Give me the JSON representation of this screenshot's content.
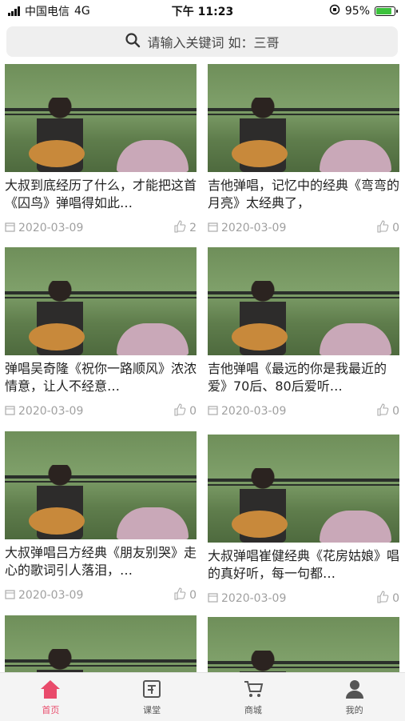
{
  "status_bar": {
    "carrier": "中国电信",
    "network": "4G",
    "time": "下午 11:23",
    "battery": "95%",
    "battery_level": 0.95
  },
  "search": {
    "placeholder": "请输入关键词  如：三哥",
    "icon": "search-icon"
  },
  "videos": [
    {
      "title": "大叔到底经历了什么，才能把这首《囚鸟》弹唱得如此…",
      "date": "2020-03-09",
      "likes": "2"
    },
    {
      "title": "吉他弹唱，记忆中的经典《弯弯的月亮》太经典了，",
      "date": "2020-03-09",
      "likes": "0"
    },
    {
      "title": "弹唱吴奇隆《祝你一路顺风》浓浓情意，让人不经意…",
      "date": "2020-03-09",
      "likes": "0"
    },
    {
      "title": "吉他弹唱《最远的你是我最近的爱》70后、80后爱听…",
      "date": "2020-03-09",
      "likes": "0"
    },
    {
      "title": "大叔弹唱吕方经典《朋友别哭》走心的歌词引人落泪，…",
      "date": "2020-03-09",
      "likes": "0"
    },
    {
      "title": "大叔弹唱崔健经典《花房姑娘》唱的真好听，每一句都…",
      "date": "2020-03-09",
      "likes": "0"
    },
    {
      "title": "",
      "date": "",
      "likes": ""
    },
    {
      "title": "",
      "date": "",
      "likes": ""
    }
  ],
  "tabs": [
    {
      "label": "首页",
      "icon": "home-icon",
      "active": true
    },
    {
      "label": "课堂",
      "icon": "classroom-icon",
      "active": false
    },
    {
      "label": "商城",
      "icon": "cart-icon",
      "active": false
    },
    {
      "label": "我的",
      "icon": "profile-icon",
      "active": false
    }
  ],
  "colors": {
    "accent": "#e94b6b",
    "meta_text": "#a0a0a0",
    "search_bg": "#efefef",
    "tabbar_bg": "#f4f4f4"
  }
}
